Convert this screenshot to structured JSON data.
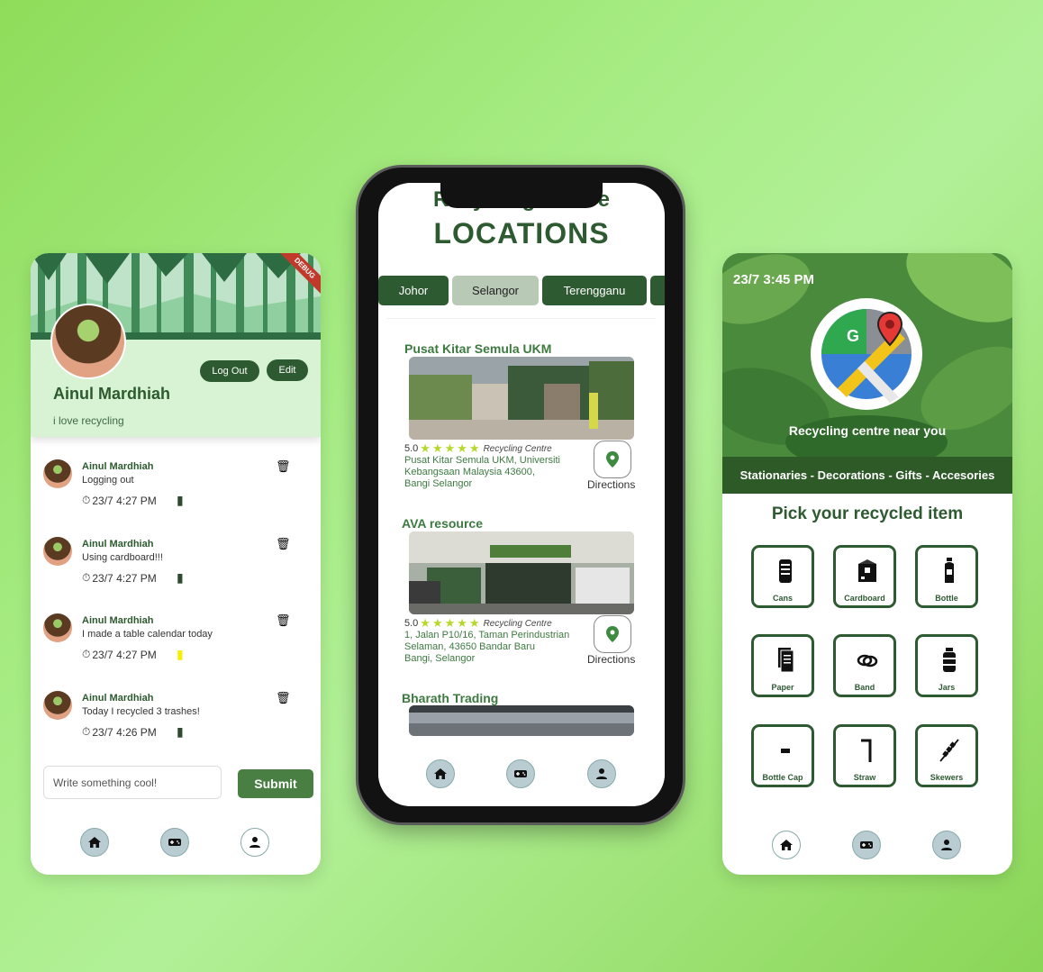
{
  "profile_screen": {
    "debug_badge": "DEBUG",
    "logout_label": "Log Out",
    "edit_label": "Edit",
    "name": "Ainul Mardhiah",
    "bio": "i love recycling",
    "posts": [
      {
        "author": "Ainul Mardhiah",
        "text": "Logging out",
        "time": "23/7 4:27 PM",
        "bookmarked": false
      },
      {
        "author": "Ainul Mardhiah",
        "text": "Using cardboard!!!",
        "time": "23/7 4:27 PM",
        "bookmarked": false
      },
      {
        "author": "Ainul Mardhiah",
        "text": "I made a table calendar today",
        "time": "23/7 4:27 PM",
        "bookmarked": true
      },
      {
        "author": "Ainul Mardhiah",
        "text": "Today I recycled 3 trashes!",
        "time": "23/7 4:26 PM",
        "bookmarked": false
      }
    ],
    "input_placeholder": "Write something cool!",
    "submit_label": "Submit"
  },
  "locations_screen": {
    "title_line1": "Recycling Centre",
    "title_line2": "LOCATIONS",
    "tabs": [
      {
        "label": "Johor",
        "active": false
      },
      {
        "label": "Selangor",
        "active": true
      },
      {
        "label": "Terengganu",
        "active": false
      }
    ],
    "centres": [
      {
        "name": "Pusat Kitar Semula UKM",
        "rating": "5.0",
        "type": "Recycling Centre",
        "address_line1": "Pusat Kitar Semula UKM, Universiti",
        "address_line2": "Kebangsaan Malaysia 43600,",
        "address_line3": "Bangi Selangor",
        "directions_label": "Directions"
      },
      {
        "name": "AVA resource",
        "rating": "5.0",
        "type": "Recycling Centre",
        "address_line1": "1, Jalan P10/16, Taman Perindustrian",
        "address_line2": "Selaman, 43650 Bandar Baru",
        "address_line3": "Bangi, Selangor",
        "directions_label": "Directions"
      },
      {
        "name": "Bharath Trading"
      }
    ]
  },
  "items_screen": {
    "time": "23/7 3:45 PM",
    "caption": "Recycling centre near you",
    "categories": "Stationaries - Decorations - Gifts - Accesories",
    "pick_title": "Pick your recycled item",
    "items": [
      {
        "label": "Cans",
        "icon": "can-icon"
      },
      {
        "label": "Cardboard",
        "icon": "cardboard-box-icon"
      },
      {
        "label": "Bottle",
        "icon": "bottle-icon"
      },
      {
        "label": "Paper",
        "icon": "paper-icon"
      },
      {
        "label": "Band",
        "icon": "rubber-band-icon"
      },
      {
        "label": "Jars",
        "icon": "jar-icon"
      },
      {
        "label": "Bottle Cap",
        "icon": "bottle-cap-icon"
      },
      {
        "label": "Straw",
        "icon": "straw-icon"
      },
      {
        "label": "Skewers",
        "icon": "skewer-icon"
      }
    ]
  },
  "nav_icons": [
    "home-icon",
    "game-controller-icon",
    "profile-icon"
  ],
  "colors": {
    "primary": "#2e5a32",
    "accent_green": "#3d7a40",
    "star": "#b6d82c",
    "bookmark_active": "#f5f000"
  }
}
